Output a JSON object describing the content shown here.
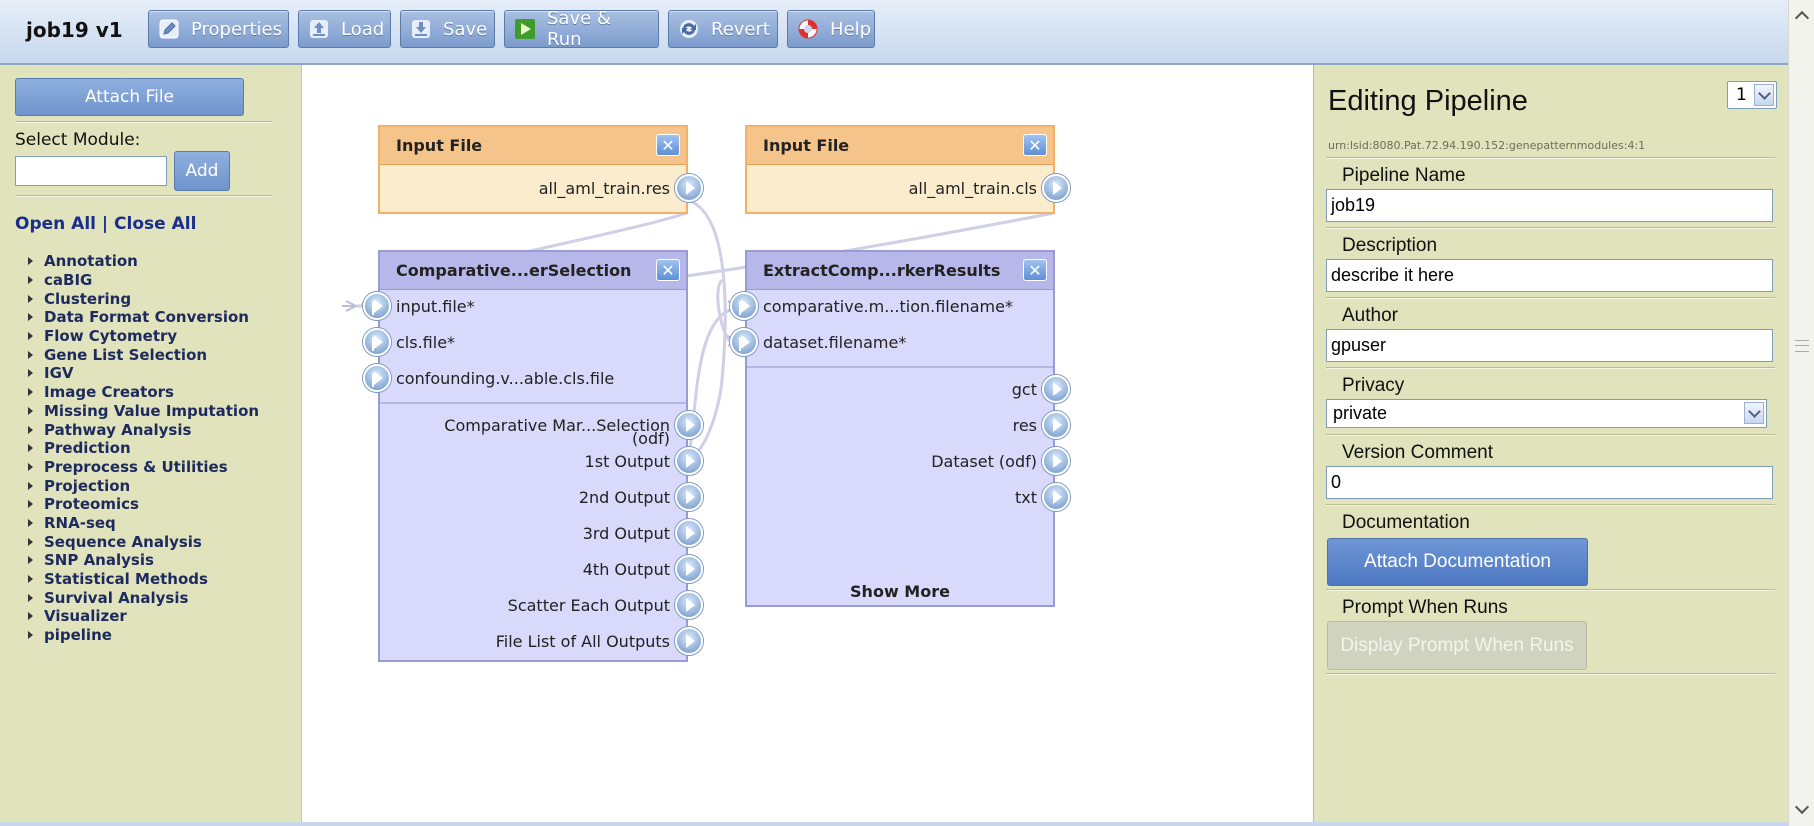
{
  "header": {
    "job_title": "job19 v1",
    "buttons": [
      {
        "label": "Properties",
        "icon": "pencil-icon"
      },
      {
        "label": "Load",
        "icon": "upload-icon"
      },
      {
        "label": "Save",
        "icon": "save-icon"
      },
      {
        "label": "Save & Run",
        "icon": "play-icon"
      },
      {
        "label": "Revert",
        "icon": "refresh-icon"
      },
      {
        "label": "Help",
        "icon": "lifebuoy-icon"
      }
    ]
  },
  "left_panel": {
    "attach_file_label": "Attach File",
    "select_module_label": "Select Module:",
    "module_input_value": "",
    "add_label": "Add",
    "open_all": "Open All",
    "separator": "|",
    "close_all": "Close All",
    "categories": [
      "Annotation",
      "caBIG",
      "Clustering",
      "Data Format Conversion",
      "Flow Cytometry",
      "Gene List Selection",
      "IGV",
      "Image Creators",
      "Missing Value Imputation",
      "Pathway Analysis",
      "Prediction",
      "Preprocess & Utilities",
      "Projection",
      "Proteomics",
      "RNA-seq",
      "Sequence Analysis",
      "SNP Analysis",
      "Statistical Methods",
      "Survival Analysis",
      "Visualizer",
      "pipeline"
    ]
  },
  "canvas": {
    "close_glyph": "✕",
    "input_file_1": {
      "title": "Input File",
      "output": "all_aml_train.res"
    },
    "input_file_2": {
      "title": "Input File",
      "output": "all_aml_train.cls"
    },
    "comparative": {
      "title": "Comparative...erSelection",
      "inputs": [
        "input.file*",
        "cls.file*",
        "confounding.v...able.cls.file"
      ],
      "outputs": [
        "Comparative Mar...Selection",
        "(odf)",
        "1st Output",
        "2nd Output",
        "3rd Output",
        "4th Output",
        "Scatter Each Output",
        "File List of All Outputs"
      ]
    },
    "extract": {
      "title": "ExtractComp...rkerResults",
      "inputs": [
        "comparative.m...tion.filename*",
        "dataset.filename*"
      ],
      "outputs": [
        "gct",
        "res",
        "Dataset (odf)",
        "txt"
      ],
      "show_more": "Show More"
    }
  },
  "right_panel": {
    "title": "Editing Pipeline",
    "version": "1",
    "urn": "urn:lsid:8080.Pat.72.94.190.152:genepatternmodules:4:1",
    "pipeline_name_label": "Pipeline Name",
    "pipeline_name": "job19",
    "description_label": "Description",
    "description": "describe it here",
    "author_label": "Author",
    "author": "gpuser",
    "privacy_label": "Privacy",
    "privacy": "private",
    "version_comment_label": "Version Comment",
    "version_comment": "0",
    "documentation_label": "Documentation",
    "attach_documentation": "Attach Documentation",
    "prompt_label": "Prompt When Runs",
    "display_prompt": "Display Prompt When Runs"
  }
}
